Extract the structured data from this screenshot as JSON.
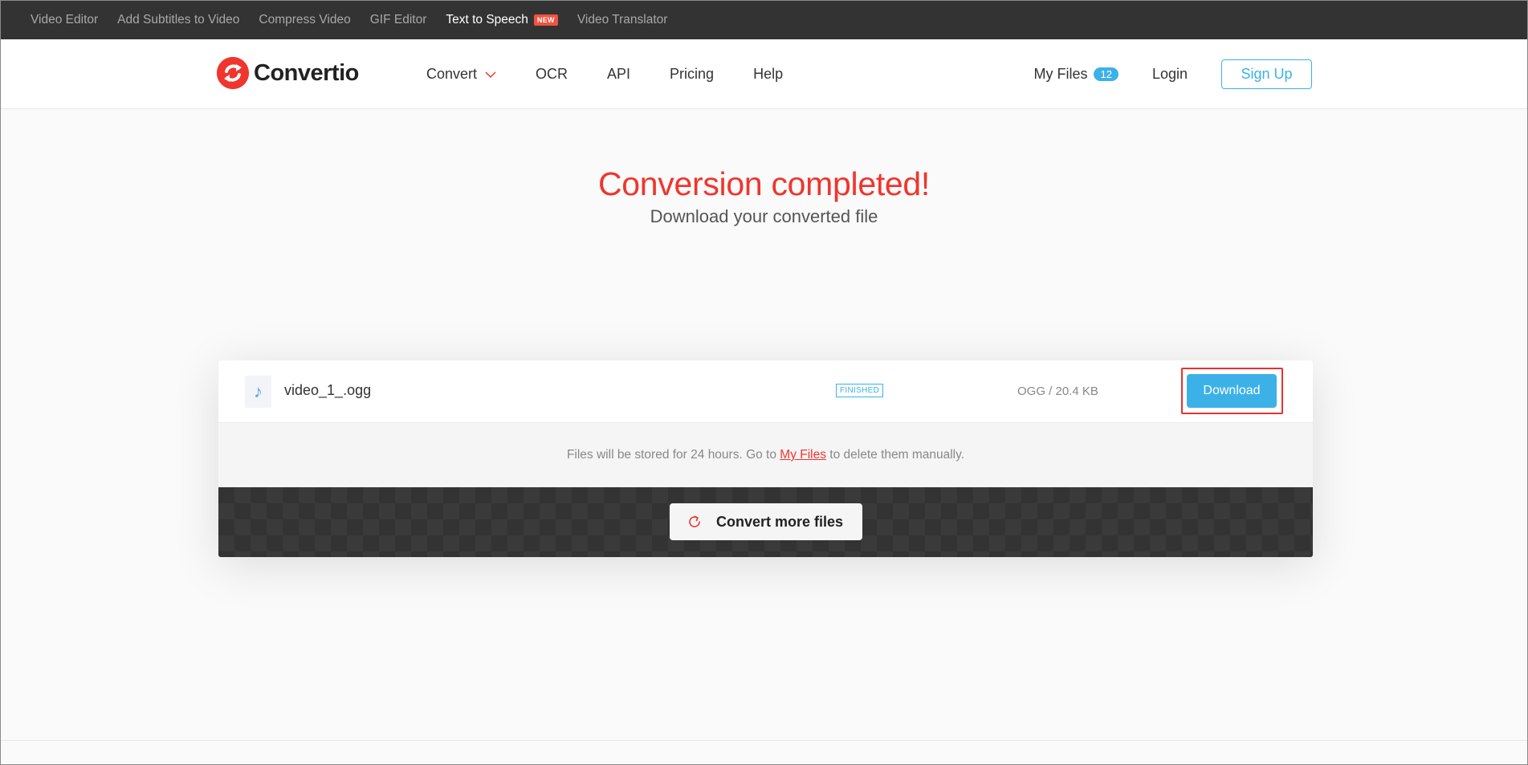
{
  "topbar": {
    "links": [
      {
        "label": "Video Editor"
      },
      {
        "label": "Add Subtitles to Video"
      },
      {
        "label": "Compress Video"
      },
      {
        "label": "GIF Editor"
      },
      {
        "label": "Text to Speech",
        "badge": "NEW"
      },
      {
        "label": "Video Translator"
      }
    ]
  },
  "header": {
    "logo_text": "Convertio",
    "nav": {
      "convert": "Convert",
      "ocr": "OCR",
      "api": "API",
      "pricing": "Pricing",
      "help": "Help"
    },
    "my_files": "My Files",
    "my_files_count": "12",
    "login": "Login",
    "signup": "Sign Up"
  },
  "hero": {
    "title": "Conversion completed!",
    "subtitle": "Download your converted file"
  },
  "file": {
    "name": "video_1_.ogg",
    "status": "FINISHED",
    "meta": "OGG / 20.4 KB",
    "download_label": "Download"
  },
  "notice": {
    "before": "Files will be stored for 24 hours. Go to ",
    "link": "My Files",
    "after": " to delete them manually."
  },
  "convert_more": {
    "label": "Convert more files"
  },
  "colors": {
    "brand_red": "#f0352e",
    "accent_blue": "#3cb1e8",
    "topbar_bg": "#333333"
  }
}
